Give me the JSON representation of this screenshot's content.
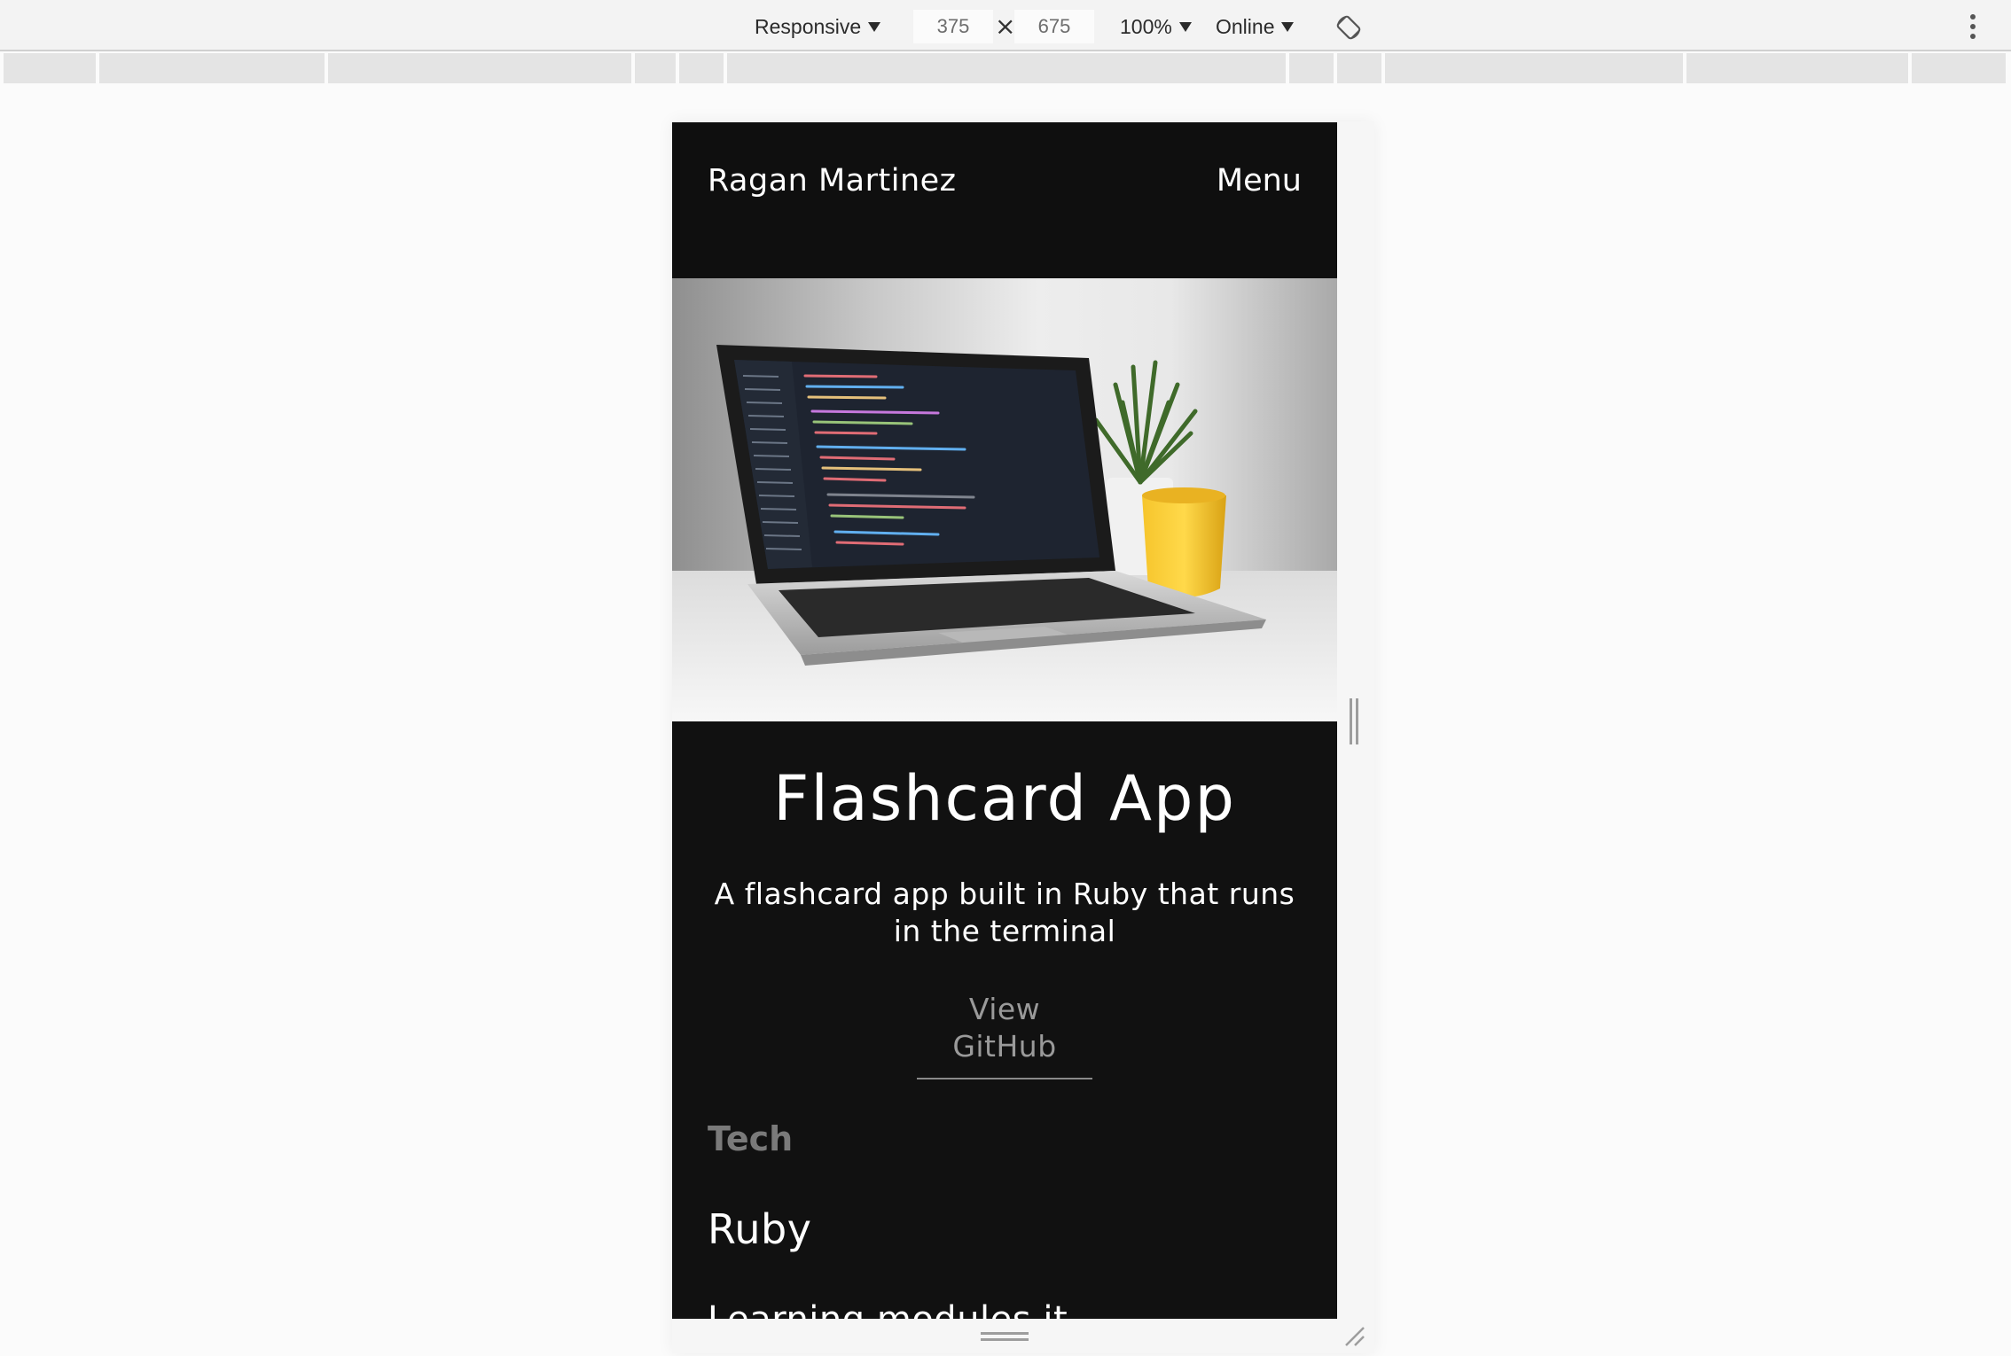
{
  "devtools": {
    "device_mode": "Responsive",
    "width": "375",
    "height": "675",
    "zoom": "100%",
    "network": "Online",
    "times_symbol": "×"
  },
  "site": {
    "brand": "Ragan Martinez",
    "menu": "Menu"
  },
  "project": {
    "title": "Flashcard App",
    "description": "A flashcard app built in Ruby that runs in the terminal",
    "github_link": "View GitHub",
    "tech_heading": "Tech",
    "tech_items": [
      "Ruby"
    ],
    "cut_off_text": "Learning modules it ..."
  },
  "colors": {
    "page_bg": "#111111",
    "text": "#ffffff",
    "muted": "#7a7a7a",
    "link": "#9a9a9a"
  }
}
